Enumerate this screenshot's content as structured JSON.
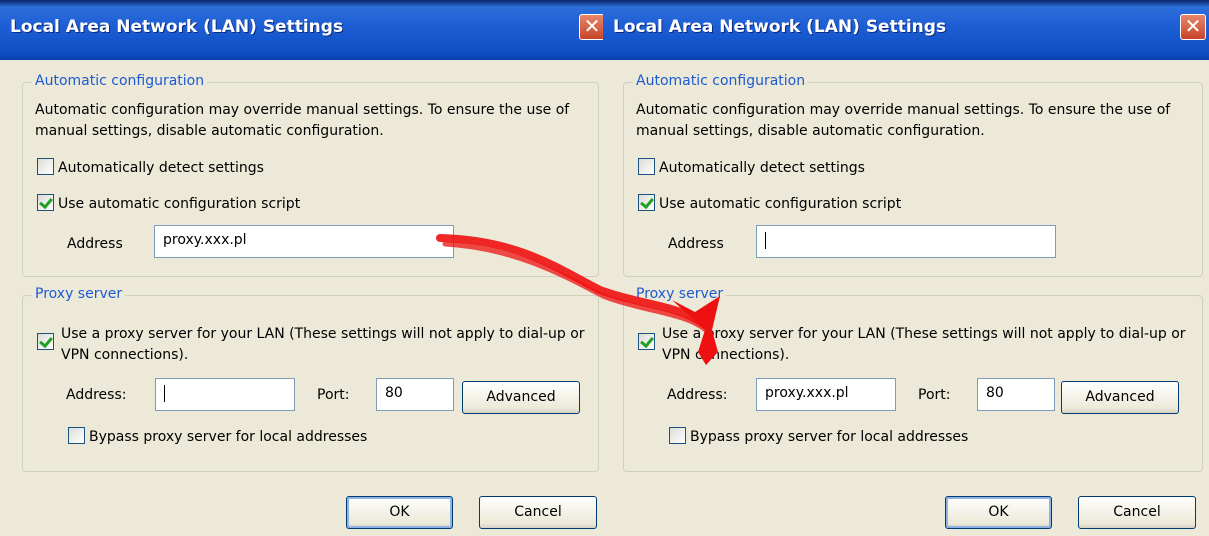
{
  "left_dialog": {
    "title": "Local Area Network (LAN) Settings",
    "close_glyph": "✕",
    "auto": {
      "legend": "Automatic configuration",
      "description": "Automatic configuration may override manual settings.  To ensure the use of manual settings, disable automatic configuration.",
      "detect_label": "Automatically detect settings",
      "detect_checked": false,
      "script_label": "Use automatic configuration script",
      "script_checked": true,
      "address_label": "Address",
      "address_value": "proxy.xxx.pl"
    },
    "proxy": {
      "legend": "Proxy server",
      "use_proxy_label": "Use a proxy server for your LAN (These settings will not apply to dial-up or VPN connections).",
      "use_proxy_checked": true,
      "address_label": "Address:",
      "address_value": "",
      "port_label": "Port:",
      "port_value": "80",
      "advanced_label": "Advanced",
      "bypass_label": "Bypass proxy server for local addresses",
      "bypass_checked": false
    },
    "ok_label": "OK",
    "cancel_label": "Cancel"
  },
  "right_dialog": {
    "title": "Local Area Network (LAN) Settings",
    "close_glyph": "✕",
    "auto": {
      "legend": "Automatic configuration",
      "description": "Automatic configuration may override manual settings.  To ensure the use of manual settings, disable automatic configuration.",
      "detect_label": "Automatically detect settings",
      "detect_checked": false,
      "script_label": "Use automatic configuration script",
      "script_checked": true,
      "address_label": "Address",
      "address_value": ""
    },
    "proxy": {
      "legend": "Proxy server",
      "use_proxy_label": "Use a proxy server for your LAN (These settings will not apply to dial-up or VPN connections).",
      "use_proxy_checked": true,
      "address_label": "Address:",
      "address_value": "proxy.xxx.pl",
      "port_label": "Port:",
      "port_value": "80",
      "advanced_label": "Advanced",
      "bypass_label": "Bypass proxy server for local addresses",
      "bypass_checked": false
    },
    "ok_label": "OK",
    "cancel_label": "Cancel"
  },
  "annotation": {
    "arrow_color": "#ee1111"
  },
  "colors": {
    "dialog_bg": "#ece9d8",
    "titlebar": "#1f5fd6",
    "legend_text": "#1d5ad0",
    "checkmark": "#21a121"
  }
}
